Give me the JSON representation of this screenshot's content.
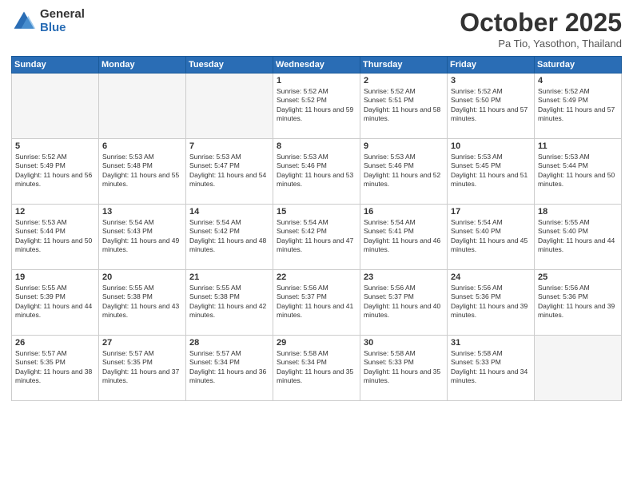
{
  "header": {
    "logo_general": "General",
    "logo_blue": "Blue",
    "month_title": "October 2025",
    "location": "Pa Tio, Yasothon, Thailand"
  },
  "weekdays": [
    "Sunday",
    "Monday",
    "Tuesday",
    "Wednesday",
    "Thursday",
    "Friday",
    "Saturday"
  ],
  "weeks": [
    [
      {
        "day": "",
        "empty": true
      },
      {
        "day": "",
        "empty": true
      },
      {
        "day": "",
        "empty": true
      },
      {
        "day": "1",
        "sunrise": "5:52 AM",
        "sunset": "5:52 PM",
        "daylight": "11 hours and 59 minutes."
      },
      {
        "day": "2",
        "sunrise": "5:52 AM",
        "sunset": "5:51 PM",
        "daylight": "11 hours and 58 minutes."
      },
      {
        "day": "3",
        "sunrise": "5:52 AM",
        "sunset": "5:50 PM",
        "daylight": "11 hours and 57 minutes."
      },
      {
        "day": "4",
        "sunrise": "5:52 AM",
        "sunset": "5:49 PM",
        "daylight": "11 hours and 57 minutes."
      }
    ],
    [
      {
        "day": "5",
        "sunrise": "5:52 AM",
        "sunset": "5:49 PM",
        "daylight": "11 hours and 56 minutes."
      },
      {
        "day": "6",
        "sunrise": "5:53 AM",
        "sunset": "5:48 PM",
        "daylight": "11 hours and 55 minutes."
      },
      {
        "day": "7",
        "sunrise": "5:53 AM",
        "sunset": "5:47 PM",
        "daylight": "11 hours and 54 minutes."
      },
      {
        "day": "8",
        "sunrise": "5:53 AM",
        "sunset": "5:46 PM",
        "daylight": "11 hours and 53 minutes."
      },
      {
        "day": "9",
        "sunrise": "5:53 AM",
        "sunset": "5:46 PM",
        "daylight": "11 hours and 52 minutes."
      },
      {
        "day": "10",
        "sunrise": "5:53 AM",
        "sunset": "5:45 PM",
        "daylight": "11 hours and 51 minutes."
      },
      {
        "day": "11",
        "sunrise": "5:53 AM",
        "sunset": "5:44 PM",
        "daylight": "11 hours and 50 minutes."
      }
    ],
    [
      {
        "day": "12",
        "sunrise": "5:53 AM",
        "sunset": "5:44 PM",
        "daylight": "11 hours and 50 minutes."
      },
      {
        "day": "13",
        "sunrise": "5:54 AM",
        "sunset": "5:43 PM",
        "daylight": "11 hours and 49 minutes."
      },
      {
        "day": "14",
        "sunrise": "5:54 AM",
        "sunset": "5:42 PM",
        "daylight": "11 hours and 48 minutes."
      },
      {
        "day": "15",
        "sunrise": "5:54 AM",
        "sunset": "5:42 PM",
        "daylight": "11 hours and 47 minutes."
      },
      {
        "day": "16",
        "sunrise": "5:54 AM",
        "sunset": "5:41 PM",
        "daylight": "11 hours and 46 minutes."
      },
      {
        "day": "17",
        "sunrise": "5:54 AM",
        "sunset": "5:40 PM",
        "daylight": "11 hours and 45 minutes."
      },
      {
        "day": "18",
        "sunrise": "5:55 AM",
        "sunset": "5:40 PM",
        "daylight": "11 hours and 44 minutes."
      }
    ],
    [
      {
        "day": "19",
        "sunrise": "5:55 AM",
        "sunset": "5:39 PM",
        "daylight": "11 hours and 44 minutes."
      },
      {
        "day": "20",
        "sunrise": "5:55 AM",
        "sunset": "5:38 PM",
        "daylight": "11 hours and 43 minutes."
      },
      {
        "day": "21",
        "sunrise": "5:55 AM",
        "sunset": "5:38 PM",
        "daylight": "11 hours and 42 minutes."
      },
      {
        "day": "22",
        "sunrise": "5:56 AM",
        "sunset": "5:37 PM",
        "daylight": "11 hours and 41 minutes."
      },
      {
        "day": "23",
        "sunrise": "5:56 AM",
        "sunset": "5:37 PM",
        "daylight": "11 hours and 40 minutes."
      },
      {
        "day": "24",
        "sunrise": "5:56 AM",
        "sunset": "5:36 PM",
        "daylight": "11 hours and 39 minutes."
      },
      {
        "day": "25",
        "sunrise": "5:56 AM",
        "sunset": "5:36 PM",
        "daylight": "11 hours and 39 minutes."
      }
    ],
    [
      {
        "day": "26",
        "sunrise": "5:57 AM",
        "sunset": "5:35 PM",
        "daylight": "11 hours and 38 minutes."
      },
      {
        "day": "27",
        "sunrise": "5:57 AM",
        "sunset": "5:35 PM",
        "daylight": "11 hours and 37 minutes."
      },
      {
        "day": "28",
        "sunrise": "5:57 AM",
        "sunset": "5:34 PM",
        "daylight": "11 hours and 36 minutes."
      },
      {
        "day": "29",
        "sunrise": "5:58 AM",
        "sunset": "5:34 PM",
        "daylight": "11 hours and 35 minutes."
      },
      {
        "day": "30",
        "sunrise": "5:58 AM",
        "sunset": "5:33 PM",
        "daylight": "11 hours and 35 minutes."
      },
      {
        "day": "31",
        "sunrise": "5:58 AM",
        "sunset": "5:33 PM",
        "daylight": "11 hours and 34 minutes."
      },
      {
        "day": "",
        "empty": true
      }
    ]
  ]
}
